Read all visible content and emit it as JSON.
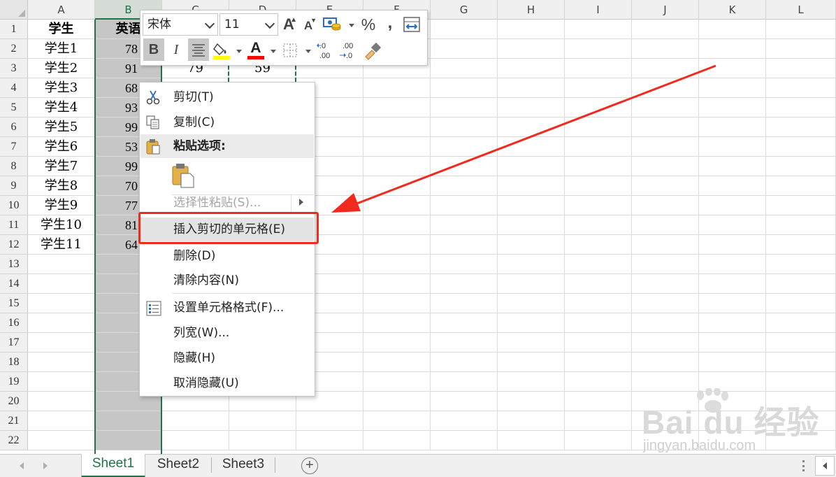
{
  "columns": [
    "A",
    "B",
    "C",
    "D",
    "E",
    "F",
    "G",
    "H",
    "I",
    "J",
    "K",
    "L"
  ],
  "rows": [
    "1",
    "2",
    "3",
    "4",
    "5",
    "6",
    "7",
    "8",
    "9",
    "10",
    "11",
    "12",
    "13",
    "14",
    "15",
    "16",
    "17",
    "18",
    "19",
    "20",
    "21",
    "22"
  ],
  "cells": {
    "A": [
      "学生",
      "学生1",
      "学生2",
      "学生3",
      "学生4",
      "学生5",
      "学生6",
      "学生7",
      "学生8",
      "学生9",
      "学生10",
      "学生11"
    ],
    "B": [
      "英语",
      "78",
      "91",
      "68",
      "93",
      "99",
      "53",
      "99",
      "70",
      "77",
      "81",
      "64"
    ],
    "C3": "79",
    "D3": "59"
  },
  "mini_toolbar": {
    "font_name": "宋体",
    "font_size": "11",
    "grow_font": "A",
    "shrink_font": "A",
    "percent": "%",
    "comma": ",",
    "bold": "B",
    "italic": "I",
    "font_color_letter": "A",
    "increase_decimal": ".0\n.00",
    "decrease_decimal": ".00\n→.0",
    "fill_color": "#ffff00",
    "font_color": "#ff0000"
  },
  "context_menu": {
    "cut": "剪切(T)",
    "copy": "复制(C)",
    "paste_options": "粘贴选项:",
    "paste_special": "选择性粘贴(S)...",
    "insert_cut_cells": "插入剪切的单元格(E)",
    "delete": "删除(D)",
    "clear_contents": "清除内容(N)",
    "format_cells": "设置单元格格式(F)...",
    "column_width": "列宽(W)...",
    "hide": "隐藏(H)",
    "unhide": "取消隐藏(U)"
  },
  "sheets": [
    "Sheet1",
    "Sheet2",
    "Sheet3"
  ],
  "active_sheet": "Sheet1",
  "watermark": {
    "brand": "Bai du 经验",
    "url": "jingyan.baidu.com"
  },
  "colors": {
    "accent": "#217346",
    "highlight_border": "#f02a1e",
    "arrow": "#f02a1e"
  }
}
